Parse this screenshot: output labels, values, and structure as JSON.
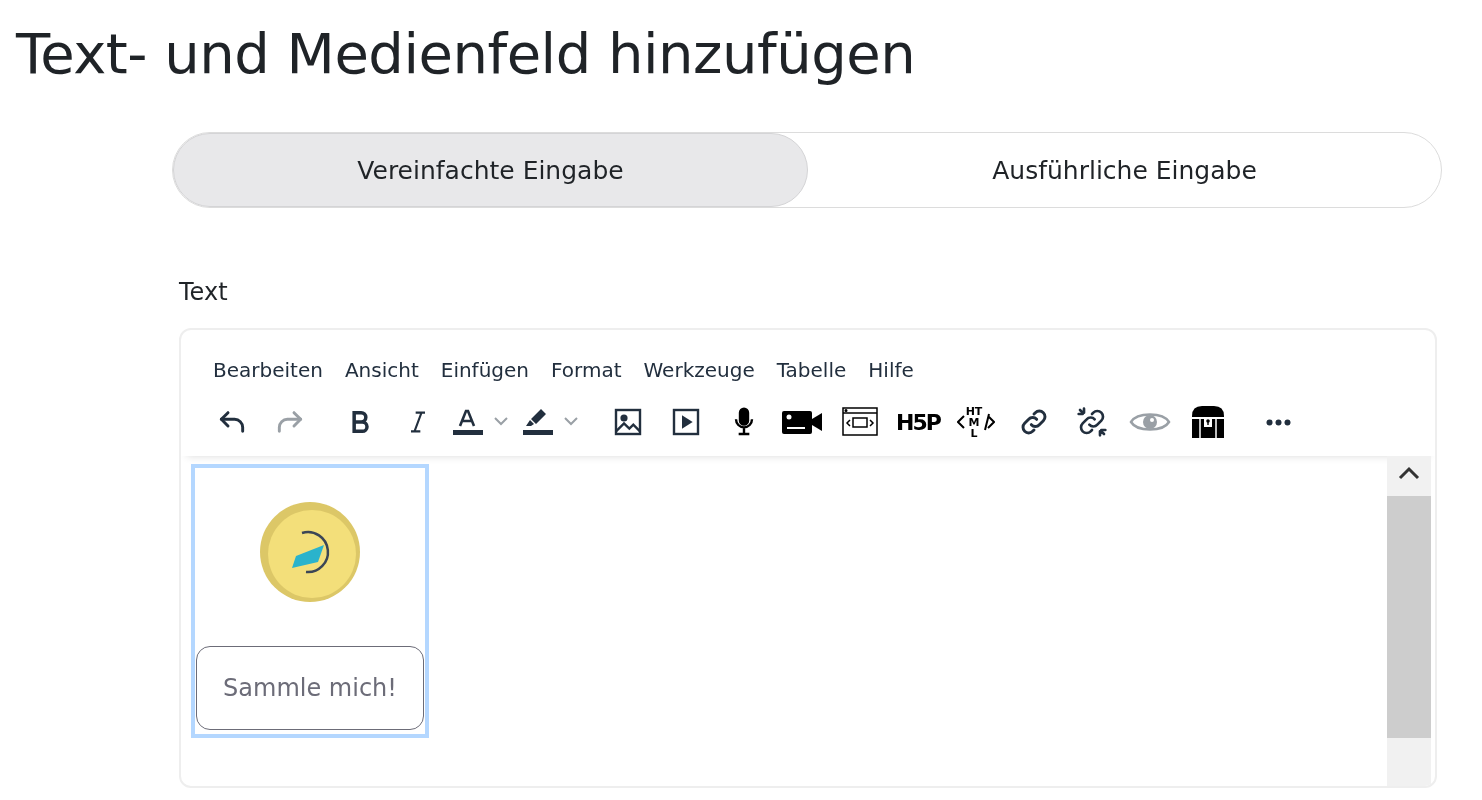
{
  "page_title": "Text- und Medienfeld hinzufügen",
  "tabs": [
    {
      "label": "Vereinfachte Eingabe",
      "selected": true
    },
    {
      "label": "Ausführliche Eingabe",
      "selected": false
    }
  ],
  "field_label": "Text",
  "editor": {
    "menu": [
      "Bearbeiten",
      "Ansicht",
      "Einfügen",
      "Format",
      "Werkzeuge",
      "Tabelle",
      "Hilfe"
    ],
    "toolbar": [
      {
        "kind": "undo",
        "disabled": false
      },
      {
        "kind": "redo",
        "disabled": true
      },
      {
        "kind": "sep"
      },
      {
        "kind": "bold",
        "disabled": false
      },
      {
        "kind": "italic",
        "disabled": false
      },
      {
        "kind": "textcolor",
        "disabled": false
      },
      {
        "kind": "highlight",
        "disabled": false
      },
      {
        "kind": "sep"
      },
      {
        "kind": "image",
        "disabled": false
      },
      {
        "kind": "media",
        "disabled": false
      },
      {
        "kind": "mic",
        "disabled": false
      },
      {
        "kind": "video",
        "disabled": false
      },
      {
        "kind": "embed",
        "disabled": false
      },
      {
        "kind": "h5p",
        "label": "H5P",
        "disabled": false
      },
      {
        "kind": "html",
        "label": "HTML",
        "disabled": false
      },
      {
        "kind": "link",
        "disabled": false
      },
      {
        "kind": "unlink",
        "disabled": false
      },
      {
        "kind": "preview",
        "disabled": true
      },
      {
        "kind": "chest",
        "disabled": false
      },
      {
        "kind": "sep"
      },
      {
        "kind": "more",
        "disabled": false
      }
    ],
    "content": {
      "selected": true,
      "badge_button": "Sammle mich!"
    }
  }
}
